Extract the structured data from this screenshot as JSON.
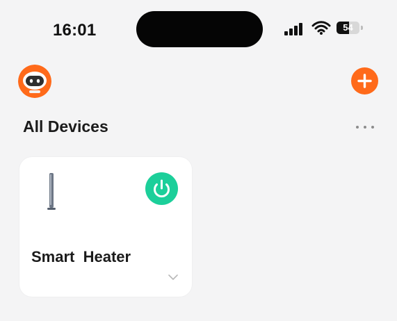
{
  "status_bar": {
    "time": "16:01",
    "battery": "54"
  },
  "header": {
    "avatar_icon": "robot-avatar-icon",
    "add_icon": "plus-icon"
  },
  "section": {
    "title": "All Devices",
    "more_icon": "more-horizontal-icon"
  },
  "devices": [
    {
      "name": "Smart  Heater",
      "device_icon": "heater-icon",
      "power_icon": "power-icon",
      "expand_icon": "chevron-down-icon"
    }
  ],
  "colors": {
    "background": "#f4f4f5",
    "card": "#ffffff",
    "accent_orange": "#ff6a1a",
    "power_green": "#1ccf9a",
    "text_primary": "#1b1b1b",
    "muted": "#8c8c8c"
  }
}
